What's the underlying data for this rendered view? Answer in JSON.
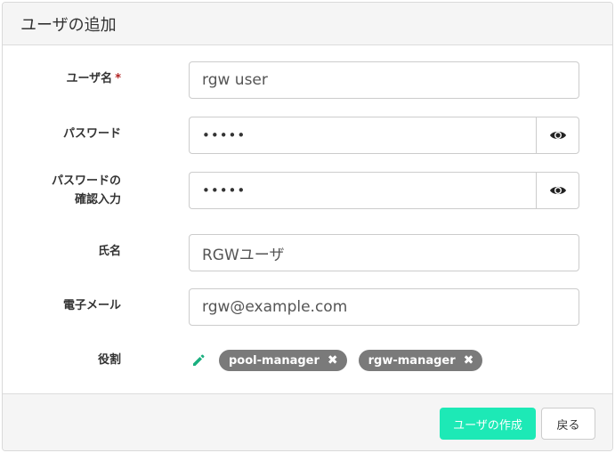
{
  "dialog": {
    "title": "ユーザの追加"
  },
  "form": {
    "username": {
      "label": "ユーザ名",
      "required_mark": "*",
      "value": "rgw user"
    },
    "password": {
      "label": "パスワード",
      "value": "•••••",
      "toggle_icon": "eye-icon"
    },
    "confirm_password": {
      "label_line1": "パスワードの",
      "label_line2": "確認入力",
      "value": "•••••",
      "toggle_icon": "eye-icon"
    },
    "full_name": {
      "label": "氏名",
      "value": "RGWユーザ"
    },
    "email": {
      "label": "電子メール",
      "value": "rgw@example.com"
    },
    "roles": {
      "label": "役割",
      "edit_icon": "pencil-icon",
      "items": [
        {
          "label": "pool-manager",
          "remove": "✖"
        },
        {
          "label": "rgw-manager",
          "remove": "✖"
        }
      ]
    }
  },
  "footer": {
    "create_label": "ユーザの作成",
    "back_label": "戻る"
  },
  "colors": {
    "primary": "#1de9b6",
    "badge": "#7a7a7a",
    "required": "#b22222",
    "edit_icon": "#1aaf7f"
  }
}
